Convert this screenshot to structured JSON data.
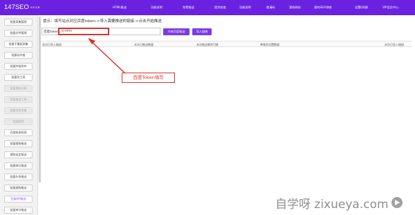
{
  "header": {
    "brand": "147SEO",
    "version": "v.4.1.6",
    "nav": [
      "HTML推送",
      "功能说明",
      "免费推送",
      "提交检查",
      "功能说明",
      "邀请码",
      "我的网站",
      "我的SEO领域",
      "设置QQ群",
      "VIP会员中心"
    ]
  },
  "sidebar": {
    "items": [
      {
        "label": "批量采集管理",
        "state": "normal"
      },
      {
        "label": "批量文件管理",
        "state": "normal"
      },
      {
        "label": "批量不重复采集",
        "state": "normal"
      },
      {
        "label": "批量站内链",
        "state": "normal"
      },
      {
        "label": "批量外链发布",
        "state": "normal"
      },
      {
        "label": "批量伪工具",
        "state": "normal"
      },
      {
        "label": "批量更新文章",
        "state": "disabled"
      },
      {
        "label": "批量推送工具",
        "state": "disabled"
      },
      {
        "label": "批量信息采集",
        "state": "disabled"
      },
      {
        "label": "批量翻译",
        "state": "disabled"
      },
      {
        "label": "百度收录检测",
        "state": "normal"
      },
      {
        "label": "批量搜狗推送",
        "state": "normal"
      },
      {
        "label": "搜狗自定推送",
        "state": "normal"
      },
      {
        "label": "批量神马推送",
        "state": "normal"
      },
      {
        "label": "批量头条推送",
        "state": "normal"
      },
      {
        "label": "批量搜狗推送",
        "state": "normal"
      },
      {
        "label": "百度API推送",
        "state": "active"
      },
      {
        "label": "批量神马推送",
        "state": "normal"
      }
    ]
  },
  "main": {
    "tip": "提示：填写站点对应百度token->导入需要推送的链接->点击开始推送",
    "token_label": "百度token",
    "token_value": "KrHMA",
    "start_button": "开始百度推送",
    "import_button": "导入链接",
    "columns": [
      "本次已导入链接",
      "本次已推送数量",
      "本次推送剩余可推",
      "单域名设置数量",
      "本次已导入链接"
    ]
  },
  "annotation": {
    "label": "百度Token填写"
  },
  "watermark": {
    "text": "自学呀 zixueya.com"
  },
  "colors": {
    "accent": "#6a22e0",
    "button": "#7b3ae6",
    "highlight": "#d8322b"
  }
}
